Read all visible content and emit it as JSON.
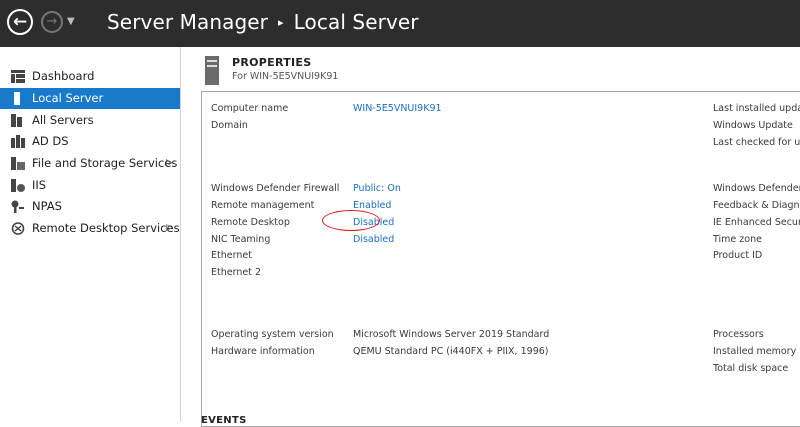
{
  "titlebar": {
    "app": "Server Manager",
    "separator": "▸",
    "page": "Local Server"
  },
  "sidebar": {
    "items": [
      {
        "label": "Dashboard",
        "icon": "dashboard-icon"
      },
      {
        "label": "Local Server",
        "icon": "local-server-icon",
        "active": true
      },
      {
        "label": "All Servers",
        "icon": "all-servers-icon"
      },
      {
        "label": "AD DS",
        "icon": "ad-ds-icon"
      },
      {
        "label": "File and Storage Services",
        "icon": "file-storage-icon",
        "chevron": "▷"
      },
      {
        "label": "IIS",
        "icon": "iis-icon"
      },
      {
        "label": "NPAS",
        "icon": "npas-icon"
      },
      {
        "label": "Remote Desktop Services",
        "icon": "remote-desktop-icon",
        "chevron": "▷"
      }
    ]
  },
  "properties": {
    "title": "PROPERTIES",
    "subtitle": "For WIN-5E5VNUI9K91",
    "rows": [
      {
        "label": "Computer name",
        "value": "WIN-5E5VNUI9K91",
        "link": true
      },
      {
        "label": "Domain",
        "value": ""
      },
      {
        "label": "Windows Defender Firewall",
        "value": "Public: On",
        "link": true
      },
      {
        "label": "Remote management",
        "value": "Enabled",
        "link": true
      },
      {
        "label": "Remote Desktop",
        "value": "Disabled",
        "link": true
      },
      {
        "label": "NIC Teaming",
        "value": "Disabled",
        "link": true
      },
      {
        "label": "Ethernet",
        "value": ""
      },
      {
        "label": "Ethernet 2",
        "value": ""
      },
      {
        "label": "Operating system version",
        "value": "Microsoft Windows Server 2019 Standard",
        "link": false
      },
      {
        "label": "Hardware information",
        "value": "QEMU Standard PC (i440FX + PIIX, 1996)",
        "link": false
      }
    ],
    "right_labels": [
      "Last installed update",
      "Windows Update",
      "Last checked for upd",
      "Windows Defender",
      "Feedback & Diagnos",
      "IE Enhanced Security",
      "Time zone",
      "Product ID",
      "Processors",
      "Installed memory (R",
      "Total disk space"
    ]
  },
  "events": {
    "title": "EVENTS"
  },
  "colors": {
    "accent": "#1979ca",
    "link": "#1a6fbf",
    "highlight": "#e0161b",
    "titlebar": "#2d2d2d"
  }
}
